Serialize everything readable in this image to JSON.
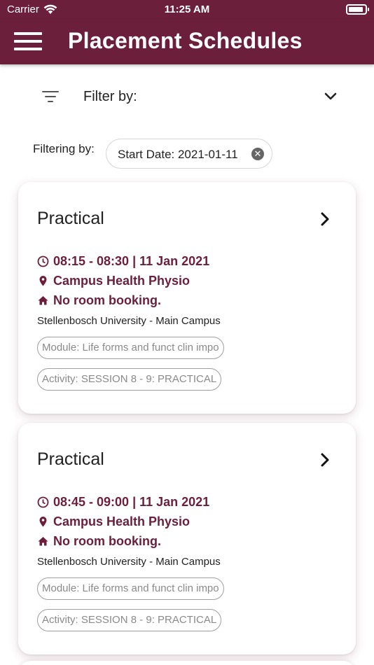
{
  "status_bar": {
    "carrier": "Carrier",
    "time": "11:25 AM"
  },
  "app_bar": {
    "title": "Placement Schedules"
  },
  "filter": {
    "label": "Filter by:",
    "filtering_label": "Filtering by:",
    "chip": "Start Date: 2021-01-11"
  },
  "cards": [
    {
      "title": "Practical",
      "time": "08:15 - 08:30 | 11 Jan 2021",
      "location": "Campus Health Physio",
      "room": "No room booking.",
      "campus": "Stellenbosch University - Main Campus",
      "module": "Module: Life forms and funct clin impo",
      "activity": "Activity: SESSION 8 - 9: PRACTICAL"
    },
    {
      "title": "Practical",
      "time": "08:45 - 09:00 | 11 Jan 2021",
      "location": "Campus Health Physio",
      "room": "No room booking.",
      "campus": "Stellenbosch University - Main Campus",
      "module": "Module: Life forms and funct clin impo",
      "activity": "Activity: SESSION 8 - 9: PRACTICAL"
    }
  ],
  "colors": {
    "brand": "#6b1f3b",
    "text": "#222222",
    "tag_text": "#8a8a8a"
  }
}
